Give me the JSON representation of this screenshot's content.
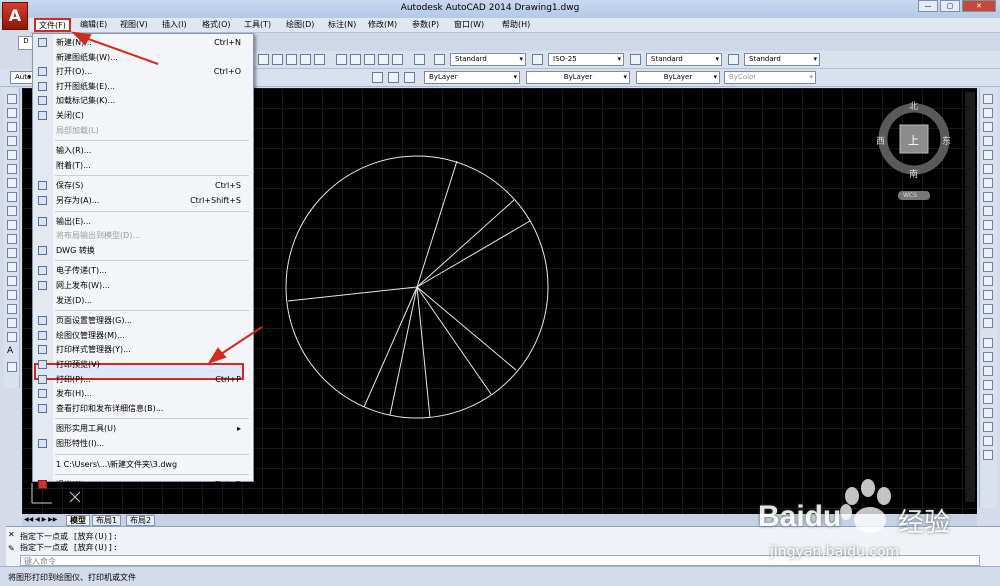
{
  "window": {
    "title": "Autodesk AutoCAD 2014    Drawing1.dwg",
    "app_button": "A"
  },
  "menubar": [
    "文件(F)",
    "编辑(E)",
    "视图(V)",
    "插入(I)",
    "格式(O)",
    "工具(T)",
    "绘图(D)",
    "标注(N)",
    "修改(M)",
    "参数(P)",
    "窗口(W)",
    "帮助(H)"
  ],
  "tab": {
    "file_tab": "D",
    "left_label": "Auto"
  },
  "toolbar": {
    "text_style": "Standard",
    "dim_style": "ISO-25",
    "table_style": "Standard",
    "mleader_style": "Standard",
    "layer_color": "ByLayer",
    "linetype": "ByLayer",
    "lineweight": "ByLayer",
    "plot_style": "ByColor"
  },
  "file_menu": [
    {
      "label": "新建(N)...",
      "shortcut": "Ctrl+N",
      "disabled": false,
      "icon": "new-icon"
    },
    {
      "label": "新建图纸集(W)...",
      "shortcut": "",
      "disabled": false,
      "icon": ""
    },
    {
      "label": "打开(O)...",
      "shortcut": "Ctrl+O",
      "disabled": false,
      "icon": "open-icon"
    },
    {
      "label": "打开图纸集(E)...",
      "shortcut": "",
      "disabled": false,
      "icon": "open-sheetset-icon"
    },
    {
      "label": "加载标记集(K)...",
      "shortcut": "",
      "disabled": false,
      "icon": "markup-icon"
    },
    {
      "label": "关闭(C)",
      "shortcut": "",
      "disabled": false,
      "icon": "close-doc-icon"
    },
    {
      "label": "局部加载(L)",
      "shortcut": "",
      "disabled": true,
      "icon": ""
    },
    {
      "sep": true
    },
    {
      "label": "输入(R)...",
      "shortcut": "",
      "disabled": false,
      "icon": ""
    },
    {
      "label": "附着(T)...",
      "shortcut": "",
      "disabled": false,
      "icon": ""
    },
    {
      "sep": true
    },
    {
      "label": "保存(S)",
      "shortcut": "Ctrl+S",
      "disabled": false,
      "icon": "save-icon"
    },
    {
      "label": "另存为(A)...",
      "shortcut": "Ctrl+Shift+S",
      "disabled": false,
      "icon": "save-as-icon"
    },
    {
      "sep": true
    },
    {
      "label": "输出(E)...",
      "shortcut": "",
      "disabled": false,
      "icon": "export-icon"
    },
    {
      "label": "将布局输出到模型(D)...",
      "shortcut": "",
      "disabled": true,
      "icon": ""
    },
    {
      "label": "DWG 转换",
      "shortcut": "",
      "disabled": false,
      "icon": "dwg-convert-icon"
    },
    {
      "sep": true
    },
    {
      "label": "电子传递(T)...",
      "shortcut": "",
      "disabled": false,
      "icon": "etransmit-icon"
    },
    {
      "label": "网上发布(W)...",
      "shortcut": "",
      "disabled": false,
      "icon": "publish-web-icon"
    },
    {
      "label": "发送(D)...",
      "shortcut": "",
      "disabled": false,
      "icon": ""
    },
    {
      "sep": true
    },
    {
      "label": "页面设置管理器(G)...",
      "shortcut": "",
      "disabled": false,
      "icon": "page-setup-icon"
    },
    {
      "label": "绘图仪管理器(M)...",
      "shortcut": "",
      "disabled": false,
      "icon": "plotter-icon"
    },
    {
      "label": "打印样式管理器(Y)...",
      "shortcut": "",
      "disabled": false,
      "icon": "plot-style-icon"
    },
    {
      "label": "打印预览(V)",
      "shortcut": "",
      "disabled": false,
      "icon": "preview-icon"
    },
    {
      "label": "打印(P)...",
      "shortcut": "Ctrl+P",
      "disabled": false,
      "icon": "print-icon",
      "highlighted": true
    },
    {
      "label": "发布(H)...",
      "shortcut": "",
      "disabled": false,
      "icon": "publish-icon"
    },
    {
      "label": "查看打印和发布详细信息(B)...",
      "shortcut": "",
      "disabled": false,
      "icon": "details-icon"
    },
    {
      "sep": true
    },
    {
      "label": "图形实用工具(U)",
      "shortcut": "▸",
      "disabled": false,
      "icon": ""
    },
    {
      "label": "图形特性(I)...",
      "shortcut": "",
      "disabled": false,
      "icon": "properties-icon"
    },
    {
      "sep": true
    },
    {
      "label": "1 C:\\Users\\...\\新建文件夹\\3.dwg",
      "shortcut": "",
      "disabled": false,
      "icon": ""
    },
    {
      "sep": true
    },
    {
      "label": "退出(X)",
      "shortcut": "Ctrl+Q",
      "disabled": false,
      "icon": "exit-icon"
    }
  ],
  "viewcube": {
    "north": "北",
    "south": "南",
    "east": "东",
    "west": "西",
    "top": "上",
    "ucs": "WCS"
  },
  "layout_tabs": [
    "模型",
    "布局1",
    "布局2"
  ],
  "command": {
    "history": [
      "指定下一点或 [放弃(U)]:",
      "指定下一点或 [放弃(U)]:"
    ],
    "placeholder": "键入命令"
  },
  "status": "将图形打印到绘图仪、打印机或文件",
  "watermark": {
    "brand": "Baidu",
    "jingyan": "经验",
    "url": "jingyan.baidu.com"
  }
}
